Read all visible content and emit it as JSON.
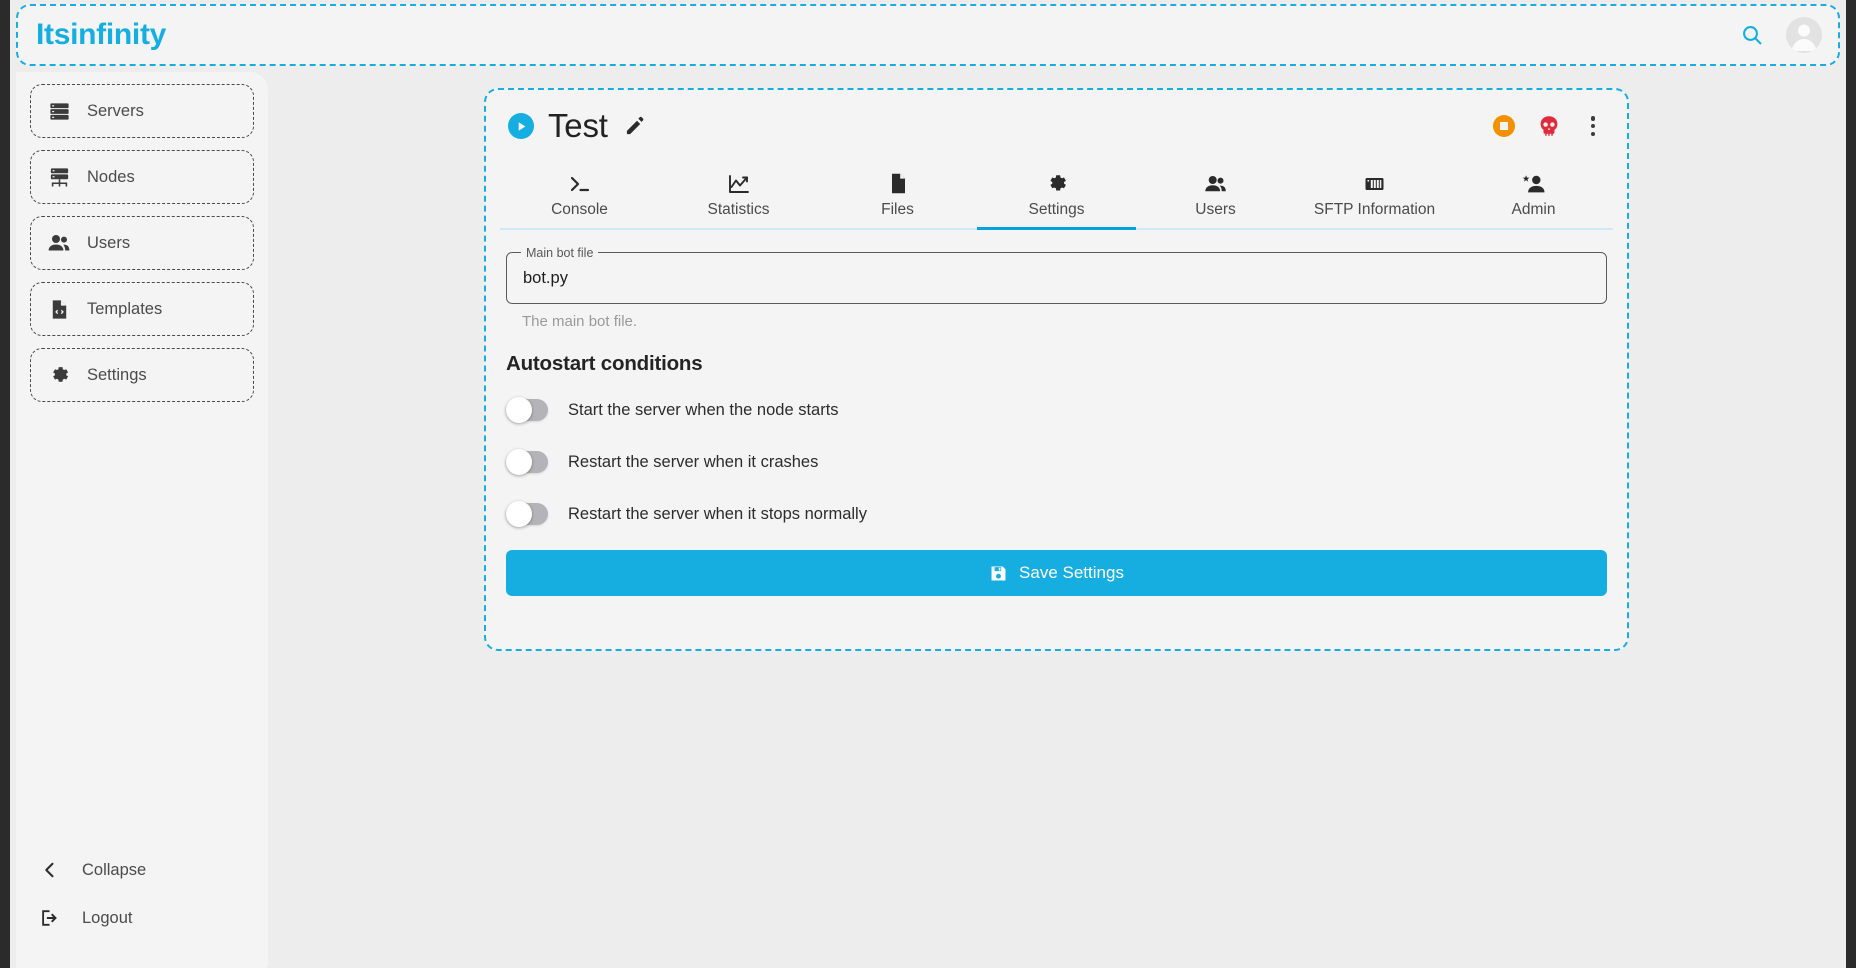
{
  "app": {
    "brand": "Itsinfinity",
    "accent_color": "#16aee0",
    "background_color": "#ededed",
    "surface_color": "#f4f4f5"
  },
  "topbar": {
    "search_icon": "search-icon",
    "avatar_icon": "user-avatar-icon"
  },
  "sidebar": {
    "items": [
      {
        "label": "Servers",
        "icon": "servers-icon"
      },
      {
        "label": "Nodes",
        "icon": "nodes-icon"
      },
      {
        "label": "Users",
        "icon": "users-icon"
      },
      {
        "label": "Templates",
        "icon": "templates-icon"
      },
      {
        "label": "Settings",
        "icon": "gear-icon"
      }
    ],
    "footer": [
      {
        "label": "Collapse",
        "icon": "chevron-left-icon"
      },
      {
        "label": "Logout",
        "icon": "logout-icon"
      }
    ]
  },
  "server": {
    "name": "Test",
    "status_icon": "play-circle-icon",
    "edit_icon": "pencil-icon",
    "actions": [
      {
        "name": "stop-button",
        "icon": "stop-circle-icon",
        "color": "#f59000"
      },
      {
        "name": "kill-button",
        "icon": "skull-icon",
        "color": "#e02b3c"
      },
      {
        "name": "more-menu-button",
        "icon": "more-vertical-icon"
      }
    ]
  },
  "tabs": [
    {
      "label": "Console",
      "icon": "terminal-icon",
      "active": false
    },
    {
      "label": "Statistics",
      "icon": "chart-line-icon",
      "active": false
    },
    {
      "label": "Files",
      "icon": "file-icon",
      "active": false
    },
    {
      "label": "Settings",
      "icon": "gear-icon",
      "active": true
    },
    {
      "label": "Users",
      "icon": "users-icon",
      "active": false
    },
    {
      "label": "SFTP Information",
      "icon": "server-rack-icon",
      "active": false
    },
    {
      "label": "Admin",
      "icon": "user-star-icon",
      "active": false
    }
  ],
  "settings": {
    "main_bot_file": {
      "label": "Main bot file",
      "value": "bot.py",
      "placeholder": "bot.py",
      "helper": "The main bot file."
    },
    "autostart": {
      "title": "Autostart conditions",
      "toggles": [
        {
          "label": "Start the server when the node starts",
          "on": false
        },
        {
          "label": "Restart the server when it crashes",
          "on": false
        },
        {
          "label": "Restart the server when it stops normally",
          "on": false
        }
      ]
    },
    "save_label": "Save Settings",
    "save_icon": "save-floppy-icon"
  }
}
